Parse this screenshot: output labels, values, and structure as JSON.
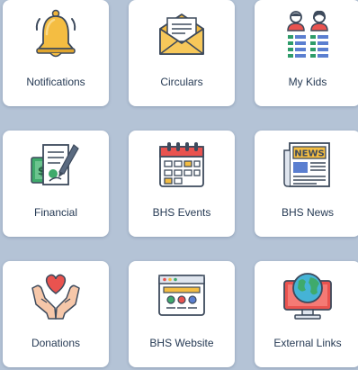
{
  "tiles": [
    {
      "label": "Notifications",
      "icon": "bell-icon"
    },
    {
      "label": "Circulars",
      "icon": "open-envelope-icon"
    },
    {
      "label": "My Kids",
      "icon": "kids-profiles-icon"
    },
    {
      "label": "Financial",
      "icon": "financial-document-icon"
    },
    {
      "label": "BHS Events",
      "icon": "calendar-icon"
    },
    {
      "label": "BHS News",
      "icon": "newspaper-icon"
    },
    {
      "label": "Donations",
      "icon": "hands-heart-icon"
    },
    {
      "label": "BHS Website",
      "icon": "website-browser-icon"
    },
    {
      "label": "External Links",
      "icon": "globe-monitor-icon"
    }
  ],
  "newspaper_masthead": "NEWS",
  "colors": {
    "background": "#b4c3d6",
    "tile": "#ffffff",
    "label": "#263a54"
  }
}
